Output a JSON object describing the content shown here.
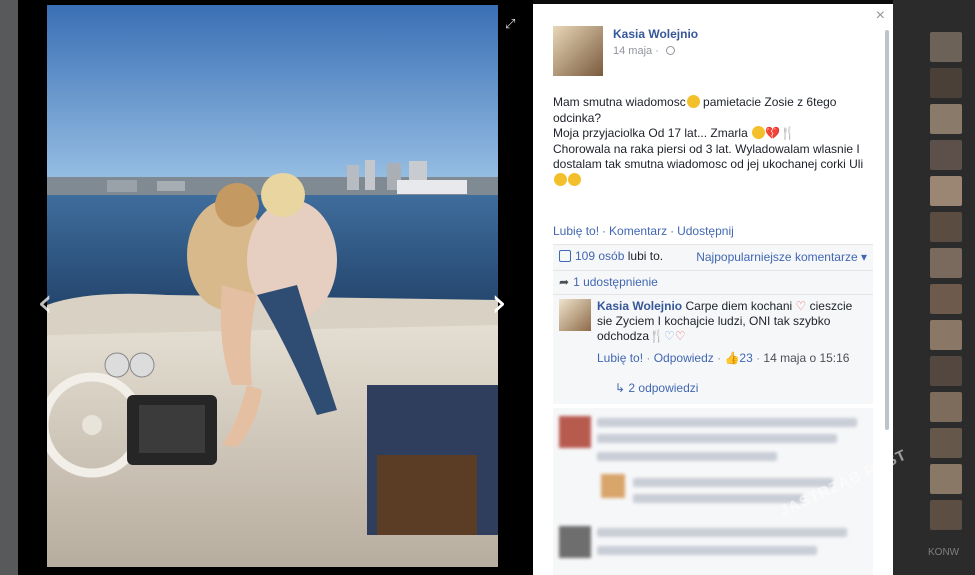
{
  "navigation": {
    "expand_icon": "expand-icon",
    "prev_glyph": "‹",
    "next_glyph": "›",
    "close_glyph": "×"
  },
  "post": {
    "author": "Kasia Wolejnio",
    "date": "14 maja · ",
    "text_line_1": "Mam smutna wiadomosc",
    "text_line_1b": " pamietacie Zosie z 6tego odcinka?",
    "text_line_2": "Moja przyjaciolka Od 17 lat... Zmarla ",
    "text_line_3": "Chorowala na raka piersi od 3 lat. Wyladowalam wlasnie I dostalam tak smutna wiadomosc od jej ukochanej corki Uli "
  },
  "actions": {
    "like": "Lubię to!",
    "comment": "Komentarz",
    "share": "Udostępnij"
  },
  "likes": {
    "count": "109 osób",
    "rest": " lubi to.",
    "sort_label": "Najpopularniejsze komentarze ▾"
  },
  "shares": {
    "label": "1 udostępnienie"
  },
  "comment": {
    "author": "Kasia Wolejnio",
    "text": " Carpe diem kochani ",
    "text_2": "cieszcie sie Zyciem I kochajcie ludzi, ONI tak szybko odchodza",
    "like": "Lubię to!",
    "reply": "Odpowiedz",
    "like_count": "23",
    "timestamp": "14 maja o 15:16",
    "replies": "2 odpowiedzi"
  },
  "watermark": "JASTRZĄB POST",
  "colors": {
    "link": "#365899",
    "accent": "#4267b2",
    "muted": "#90949c"
  }
}
